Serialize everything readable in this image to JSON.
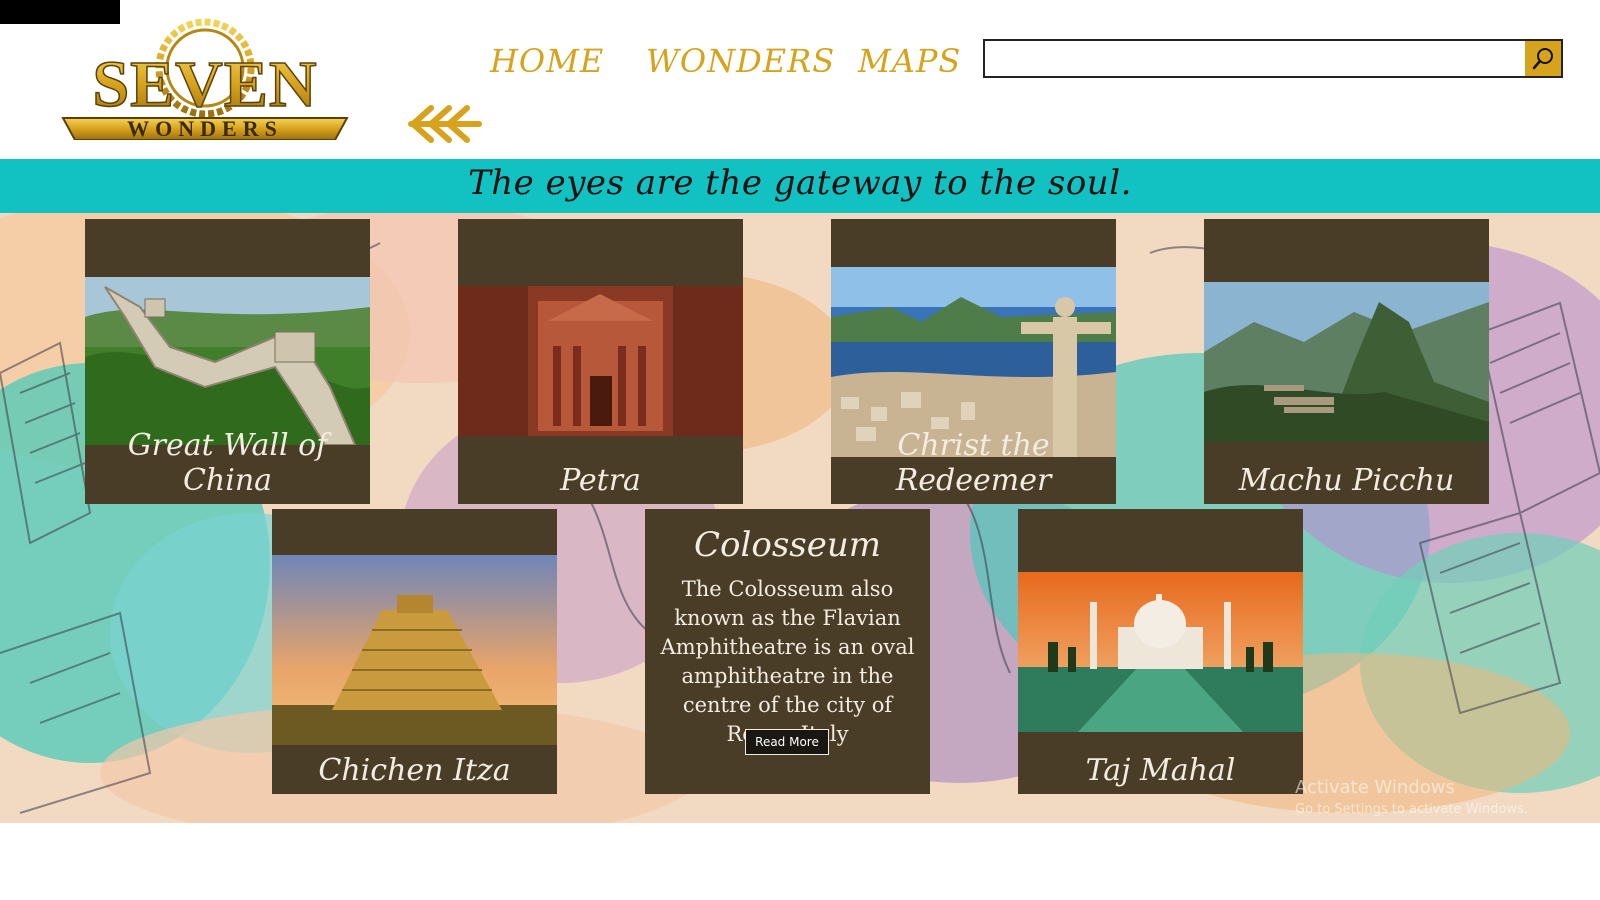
{
  "logo": {
    "line1": "SEVEN",
    "line2": "WONDERS"
  },
  "nav": {
    "home": "HOME",
    "wonders": "WONDERS",
    "maps": "MAPS"
  },
  "icons": {
    "back": "double-arrow-left-icon",
    "search": "search-icon"
  },
  "search": {
    "value": "",
    "placeholder": ""
  },
  "banner": {
    "text": "The eyes are the gateway to the soul."
  },
  "wonders": [
    {
      "name": "Great Wall of China"
    },
    {
      "name": "Petra"
    },
    {
      "name": "Christ the Redeemer"
    },
    {
      "name": "Machu Picchu"
    },
    {
      "name": "Chichen Itza"
    },
    {
      "name": "Colosseum",
      "description": "The Colosseum also known as the Flavian Amphitheatre is an oval amphitheatre in the centre of the city of Rome, Italy",
      "button": "Read More"
    },
    {
      "name": "Taj Mahal"
    }
  ],
  "watermark": {
    "title": "Activate Windows",
    "subtitle": "Go to Settings to activate Windows."
  },
  "colors": {
    "accent": "#d7a21c",
    "banner": "#12c2c2",
    "card": "#4a3d28",
    "card_text": "#f3ece0"
  }
}
